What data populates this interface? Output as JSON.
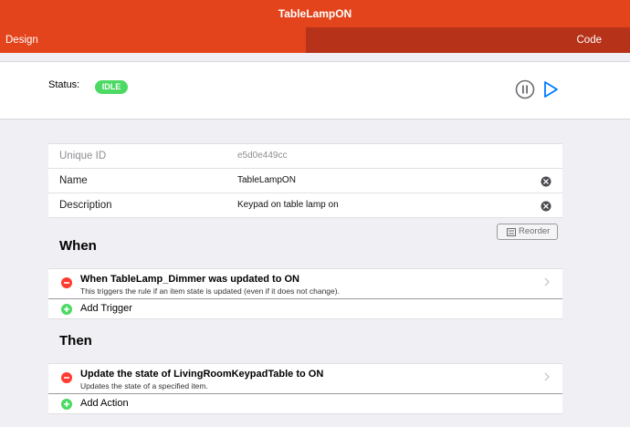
{
  "header": {
    "title": "TableLampON"
  },
  "tabs": {
    "design": "Design",
    "code": "Code"
  },
  "status": {
    "label": "Status:",
    "badge": "IDLE"
  },
  "properties": [
    {
      "label": "Unique ID",
      "value": "e5d0e449cc"
    },
    {
      "label": "Name",
      "value": "TableLampON"
    },
    {
      "label": "Description",
      "value": "Keypad on table lamp on"
    }
  ],
  "toolbar": {
    "reorder_label": "Reorder"
  },
  "when": {
    "heading": "When",
    "item": {
      "title": "When TableLamp_Dimmer was updated to ON",
      "subtitle": "This triggers the rule if an item state is updated (even if it does not change)."
    },
    "add_label": "Add Trigger"
  },
  "then": {
    "heading": "Then",
    "item": {
      "title": "Update the state of LivingRoomKeypadTable to ON",
      "subtitle": "Updates the state of a specified item."
    },
    "add_label": "Add Action"
  },
  "colors": {
    "accent": "#e3441b",
    "active_tab": "#b63219",
    "status_idle": "#4cd964",
    "remove": "#ff3b30",
    "add": "#4cd964",
    "play": "#007aff"
  },
  "icons": [
    "pause-icon",
    "play-icon",
    "clear-icon",
    "reorder-icon",
    "remove-icon",
    "add-icon",
    "chevron-right-icon"
  ]
}
